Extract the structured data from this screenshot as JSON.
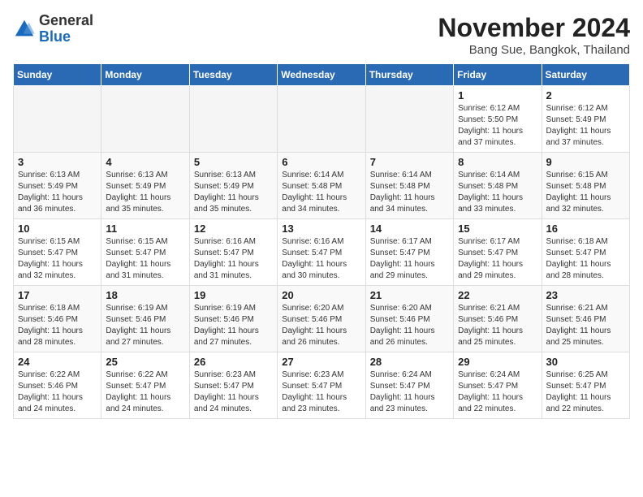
{
  "logo": {
    "general": "General",
    "blue": "Blue"
  },
  "header": {
    "month": "November 2024",
    "location": "Bang Sue, Bangkok, Thailand"
  },
  "days_of_week": [
    "Sunday",
    "Monday",
    "Tuesday",
    "Wednesday",
    "Thursday",
    "Friday",
    "Saturday"
  ],
  "weeks": [
    [
      {
        "num": "",
        "info": ""
      },
      {
        "num": "",
        "info": ""
      },
      {
        "num": "",
        "info": ""
      },
      {
        "num": "",
        "info": ""
      },
      {
        "num": "",
        "info": ""
      },
      {
        "num": "1",
        "info": "Sunrise: 6:12 AM\nSunset: 5:50 PM\nDaylight: 11 hours and 37 minutes."
      },
      {
        "num": "2",
        "info": "Sunrise: 6:12 AM\nSunset: 5:49 PM\nDaylight: 11 hours and 37 minutes."
      }
    ],
    [
      {
        "num": "3",
        "info": "Sunrise: 6:13 AM\nSunset: 5:49 PM\nDaylight: 11 hours and 36 minutes."
      },
      {
        "num": "4",
        "info": "Sunrise: 6:13 AM\nSunset: 5:49 PM\nDaylight: 11 hours and 35 minutes."
      },
      {
        "num": "5",
        "info": "Sunrise: 6:13 AM\nSunset: 5:49 PM\nDaylight: 11 hours and 35 minutes."
      },
      {
        "num": "6",
        "info": "Sunrise: 6:14 AM\nSunset: 5:48 PM\nDaylight: 11 hours and 34 minutes."
      },
      {
        "num": "7",
        "info": "Sunrise: 6:14 AM\nSunset: 5:48 PM\nDaylight: 11 hours and 34 minutes."
      },
      {
        "num": "8",
        "info": "Sunrise: 6:14 AM\nSunset: 5:48 PM\nDaylight: 11 hours and 33 minutes."
      },
      {
        "num": "9",
        "info": "Sunrise: 6:15 AM\nSunset: 5:48 PM\nDaylight: 11 hours and 32 minutes."
      }
    ],
    [
      {
        "num": "10",
        "info": "Sunrise: 6:15 AM\nSunset: 5:47 PM\nDaylight: 11 hours and 32 minutes."
      },
      {
        "num": "11",
        "info": "Sunrise: 6:15 AM\nSunset: 5:47 PM\nDaylight: 11 hours and 31 minutes."
      },
      {
        "num": "12",
        "info": "Sunrise: 6:16 AM\nSunset: 5:47 PM\nDaylight: 11 hours and 31 minutes."
      },
      {
        "num": "13",
        "info": "Sunrise: 6:16 AM\nSunset: 5:47 PM\nDaylight: 11 hours and 30 minutes."
      },
      {
        "num": "14",
        "info": "Sunrise: 6:17 AM\nSunset: 5:47 PM\nDaylight: 11 hours and 29 minutes."
      },
      {
        "num": "15",
        "info": "Sunrise: 6:17 AM\nSunset: 5:47 PM\nDaylight: 11 hours and 29 minutes."
      },
      {
        "num": "16",
        "info": "Sunrise: 6:18 AM\nSunset: 5:47 PM\nDaylight: 11 hours and 28 minutes."
      }
    ],
    [
      {
        "num": "17",
        "info": "Sunrise: 6:18 AM\nSunset: 5:46 PM\nDaylight: 11 hours and 28 minutes."
      },
      {
        "num": "18",
        "info": "Sunrise: 6:19 AM\nSunset: 5:46 PM\nDaylight: 11 hours and 27 minutes."
      },
      {
        "num": "19",
        "info": "Sunrise: 6:19 AM\nSunset: 5:46 PM\nDaylight: 11 hours and 27 minutes."
      },
      {
        "num": "20",
        "info": "Sunrise: 6:20 AM\nSunset: 5:46 PM\nDaylight: 11 hours and 26 minutes."
      },
      {
        "num": "21",
        "info": "Sunrise: 6:20 AM\nSunset: 5:46 PM\nDaylight: 11 hours and 26 minutes."
      },
      {
        "num": "22",
        "info": "Sunrise: 6:21 AM\nSunset: 5:46 PM\nDaylight: 11 hours and 25 minutes."
      },
      {
        "num": "23",
        "info": "Sunrise: 6:21 AM\nSunset: 5:46 PM\nDaylight: 11 hours and 25 minutes."
      }
    ],
    [
      {
        "num": "24",
        "info": "Sunrise: 6:22 AM\nSunset: 5:46 PM\nDaylight: 11 hours and 24 minutes."
      },
      {
        "num": "25",
        "info": "Sunrise: 6:22 AM\nSunset: 5:47 PM\nDaylight: 11 hours and 24 minutes."
      },
      {
        "num": "26",
        "info": "Sunrise: 6:23 AM\nSunset: 5:47 PM\nDaylight: 11 hours and 24 minutes."
      },
      {
        "num": "27",
        "info": "Sunrise: 6:23 AM\nSunset: 5:47 PM\nDaylight: 11 hours and 23 minutes."
      },
      {
        "num": "28",
        "info": "Sunrise: 6:24 AM\nSunset: 5:47 PM\nDaylight: 11 hours and 23 minutes."
      },
      {
        "num": "29",
        "info": "Sunrise: 6:24 AM\nSunset: 5:47 PM\nDaylight: 11 hours and 22 minutes."
      },
      {
        "num": "30",
        "info": "Sunrise: 6:25 AM\nSunset: 5:47 PM\nDaylight: 11 hours and 22 minutes."
      }
    ]
  ]
}
